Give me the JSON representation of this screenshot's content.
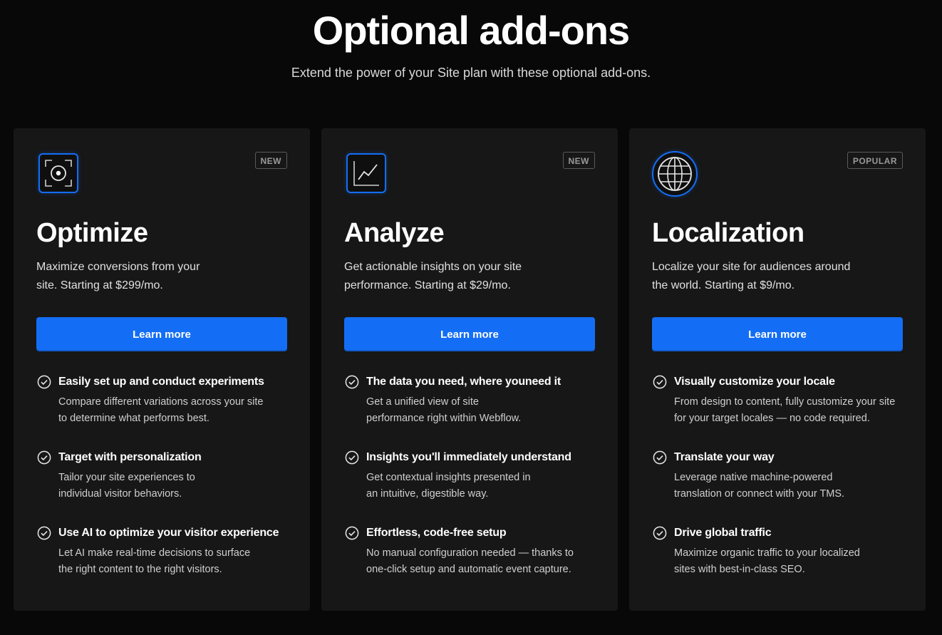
{
  "header": {
    "title": "Optional add-ons",
    "subtitle": "Extend the power of your Site plan with these optional add-ons."
  },
  "colors": {
    "accent": "#146ef5",
    "background": "#080808",
    "card": "#171717"
  },
  "cards": [
    {
      "icon": "target-icon",
      "badge": "NEW",
      "title": "Optimize",
      "description": "Maximize conversions from your site. Starting at $299/mo.",
      "button": "Learn more",
      "features": [
        {
          "title": "Easily set up and conduct experiments",
          "description": "Compare different variations across your site to determine what performs best."
        },
        {
          "title": "Target with personalization",
          "description": "Tailor your site experiences to individual visitor behaviors."
        },
        {
          "title": "Use AI to optimize your visitor experience",
          "description": "Let AI make real-time decisions to surface the right content to the right visitors."
        }
      ]
    },
    {
      "icon": "line-chart-icon",
      "badge": "NEW",
      "title": "Analyze",
      "description": "Get actionable insights on your site performance. Starting at $29/mo.",
      "button": "Learn more",
      "features": [
        {
          "title": "The data you need, where youneed it",
          "description": "Get a unified view of site performance right within Webflow."
        },
        {
          "title": "Insights you'll immediately understand",
          "description": "Get contextual insights presented in an intuitive, digestible way."
        },
        {
          "title": "Effortless, code-free setup",
          "description": "No manual configuration needed — thanks to one-click setup and automatic event capture."
        }
      ]
    },
    {
      "icon": "globe-icon",
      "badge": "POPULAR",
      "title": "Localization",
      "description": "Localize your site for audiences around the world. Starting at $9/mo.",
      "button": "Learn more",
      "features": [
        {
          "title": "Visually customize your locale",
          "description": "From design to content, fully customize your site for your target locales — no code required."
        },
        {
          "title": "Translate your way",
          "description": "Leverage native machine-powered translation or connect with your TMS."
        },
        {
          "title": "Drive global traffic",
          "description": "Maximize organic traffic to your localized sites with best-in-class SEO."
        }
      ]
    }
  ]
}
